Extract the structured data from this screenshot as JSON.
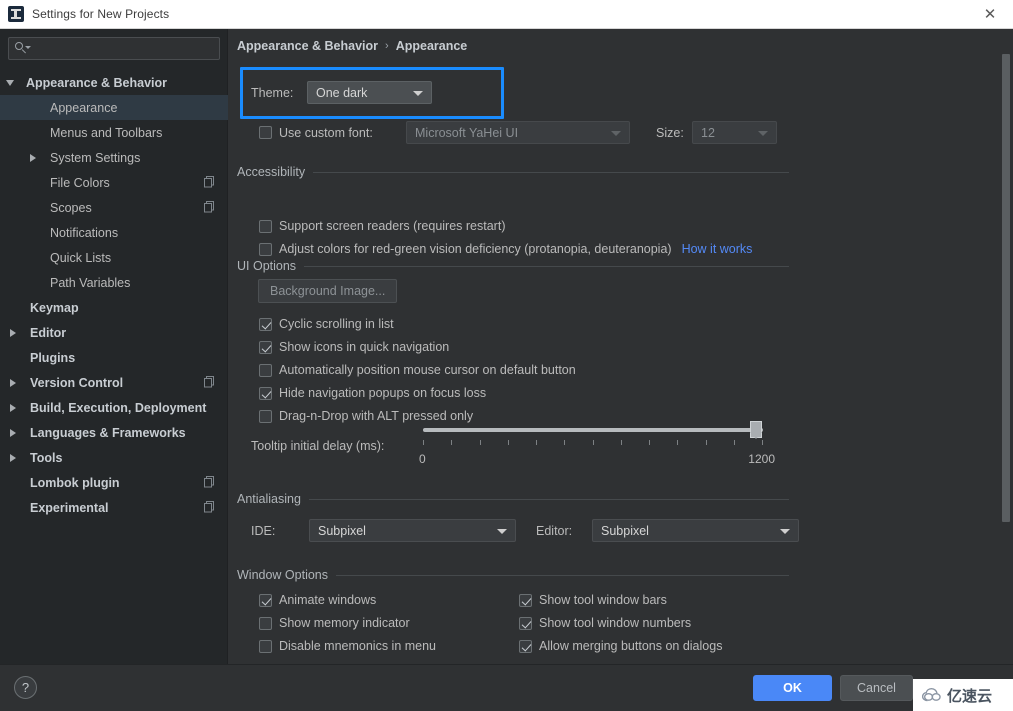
{
  "window": {
    "title": "Settings for New Projects",
    "app_icon": "intellij-idea-icon",
    "close_label": "✕"
  },
  "sidebar": {
    "search": {
      "value": "",
      "placeholder": "",
      "icon": "search-icon"
    },
    "items": [
      {
        "label": "Appearance & Behavior",
        "indent": 26,
        "arrow": "down",
        "bold": true,
        "selected": false,
        "copy": false
      },
      {
        "label": "Appearance",
        "indent": 50,
        "arrow": "none",
        "bold": false,
        "selected": true,
        "copy": false
      },
      {
        "label": "Menus and Toolbars",
        "indent": 50,
        "arrow": "none",
        "bold": false,
        "selected": false,
        "copy": false
      },
      {
        "label": "System Settings",
        "indent": 50,
        "arrow": "right",
        "bold": false,
        "selected": false,
        "copy": false
      },
      {
        "label": "File Colors",
        "indent": 50,
        "arrow": "none",
        "bold": false,
        "selected": false,
        "copy": true
      },
      {
        "label": "Scopes",
        "indent": 50,
        "arrow": "none",
        "bold": false,
        "selected": false,
        "copy": true
      },
      {
        "label": "Notifications",
        "indent": 50,
        "arrow": "none",
        "bold": false,
        "selected": false,
        "copy": false
      },
      {
        "label": "Quick Lists",
        "indent": 50,
        "arrow": "none",
        "bold": false,
        "selected": false,
        "copy": false
      },
      {
        "label": "Path Variables",
        "indent": 50,
        "arrow": "none",
        "bold": false,
        "selected": false,
        "copy": false
      },
      {
        "label": "Keymap",
        "indent": 30,
        "arrow": "none",
        "bold": true,
        "selected": false,
        "copy": false
      },
      {
        "label": "Editor",
        "indent": 30,
        "arrow": "right",
        "bold": true,
        "selected": false,
        "copy": false
      },
      {
        "label": "Plugins",
        "indent": 30,
        "arrow": "none",
        "bold": true,
        "selected": false,
        "copy": false
      },
      {
        "label": "Version Control",
        "indent": 30,
        "arrow": "right",
        "bold": true,
        "selected": false,
        "copy": true
      },
      {
        "label": "Build, Execution, Deployment",
        "indent": 30,
        "arrow": "right",
        "bold": true,
        "selected": false,
        "copy": false
      },
      {
        "label": "Languages & Frameworks",
        "indent": 30,
        "arrow": "right",
        "bold": true,
        "selected": false,
        "copy": false
      },
      {
        "label": "Tools",
        "indent": 30,
        "arrow": "right",
        "bold": true,
        "selected": false,
        "copy": false
      },
      {
        "label": "Lombok plugin",
        "indent": 30,
        "arrow": "none",
        "bold": true,
        "selected": false,
        "copy": true
      },
      {
        "label": "Experimental",
        "indent": 30,
        "arrow": "none",
        "bold": true,
        "selected": false,
        "copy": true
      }
    ]
  },
  "panel": {
    "breadcrumb": {
      "root": "Appearance & Behavior",
      "separator": "›",
      "leaf": "Appearance"
    },
    "theme": {
      "label": "Theme:",
      "value": "One dark",
      "highlight_color": "#1a8cff"
    },
    "custom_font": {
      "label": "Use custom font:",
      "checked": false,
      "font_value": "Microsoft YaHei UI",
      "size_label": "Size:",
      "size_value": "12"
    },
    "accessibility": {
      "title": "Accessibility",
      "options": [
        {
          "label": "Support screen readers (requires restart)",
          "checked": false
        },
        {
          "label": "Adjust colors for red-green vision deficiency (protanopia, deuteranopia)",
          "checked": false
        }
      ],
      "link": "How it works",
      "link_color": "#548af7"
    },
    "ui_options": {
      "title": "UI Options",
      "background_image_button": "Background Image...",
      "options": [
        {
          "label": "Cyclic scrolling in list",
          "checked": true
        },
        {
          "label": "Show icons in quick navigation",
          "checked": true
        },
        {
          "label": "Automatically position mouse cursor on default button",
          "checked": false
        },
        {
          "label": "Hide navigation popups on focus loss",
          "checked": true
        },
        {
          "label": "Drag-n-Drop with ALT pressed only",
          "checked": false
        }
      ],
      "tooltip_delay": {
        "label": "Tooltip initial delay (ms):",
        "min_label": "0",
        "max_label": "1200",
        "min": 0,
        "max": 1200,
        "value": 1200,
        "tick_count": 13
      }
    },
    "antialiasing": {
      "title": "Antialiasing",
      "ide_label": "IDE:",
      "ide_value": "Subpixel",
      "editor_label": "Editor:",
      "editor_value": "Subpixel"
    },
    "window_options": {
      "title": "Window Options",
      "left_column": [
        {
          "label": "Animate windows",
          "checked": true
        },
        {
          "label": "Show memory indicator",
          "checked": false
        },
        {
          "label": "Disable mnemonics in menu",
          "checked": false
        }
      ],
      "right_column": [
        {
          "label": "Show tool window bars",
          "checked": true
        },
        {
          "label": "Show tool window numbers",
          "checked": true
        },
        {
          "label": "Allow merging buttons on dialogs",
          "checked": true
        }
      ]
    }
  },
  "footer": {
    "help_label": "?",
    "ok_label": "OK",
    "cancel_label": "Cancel"
  },
  "watermark": {
    "text": "亿速云",
    "logo": "cloud-icon"
  }
}
